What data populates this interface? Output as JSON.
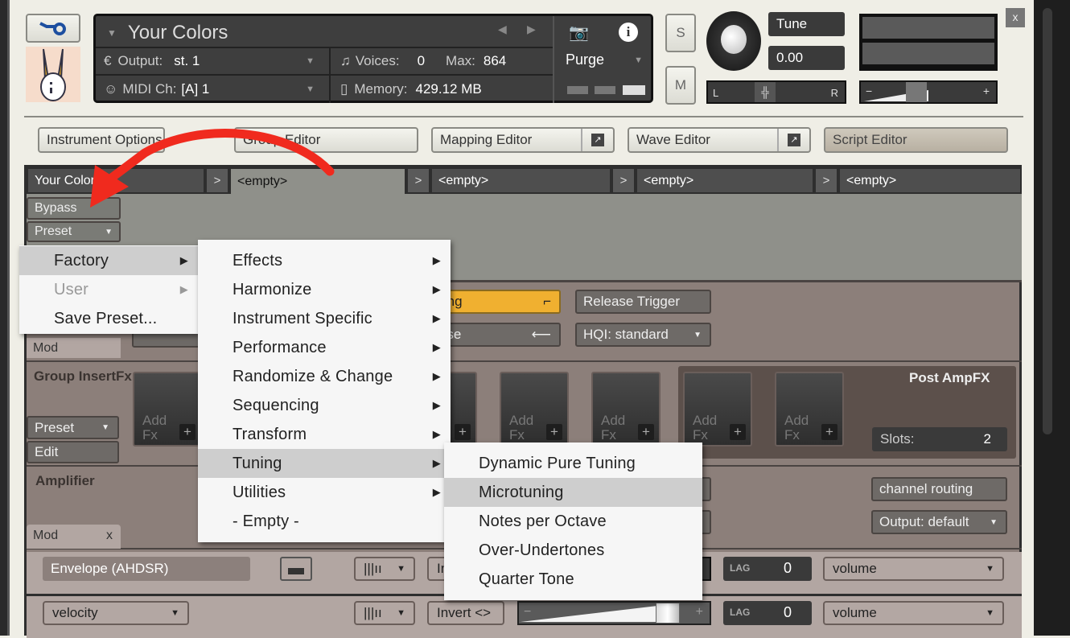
{
  "header": {
    "title": "Your Colors",
    "output_label": "Output:",
    "output_value": "st. 1",
    "midi_label": "MIDI Ch:",
    "midi_value": "[A]  1",
    "voices_label": "Voices:",
    "voices_value": "0",
    "max_label": "Max:",
    "max_value": "864",
    "memory_label": "Memory:",
    "memory_value": "429.12 MB",
    "purge_label": "Purge",
    "tune_label": "Tune",
    "tune_value": "0.00",
    "solo": "S",
    "mute": "M",
    "pan_left": "L",
    "pan_right": "R",
    "vol_minus": "−",
    "vol_plus": "+",
    "close": "x"
  },
  "editors": [
    "Instrument Options",
    "Group Editor",
    "Mapping Editor",
    "Wave Editor",
    "Script Editor"
  ],
  "tabs": [
    {
      "label": "Your Colors"
    },
    {
      "label": "<empty>"
    },
    {
      "label": "<empty>"
    },
    {
      "label": "<empty>"
    },
    {
      "label": "<empty>"
    }
  ],
  "tab_arrow": ">",
  "group": {
    "bypass": "Bypass",
    "preset": "Preset",
    "mod": "Mod"
  },
  "source": {
    "tracking": "Tracking",
    "release_trigger": "Release Trigger",
    "reverse": "Reverse",
    "hqi": "HQI: standard"
  },
  "insertfx": {
    "title": "Group InsertFx",
    "preset": "Preset",
    "edit": "Edit",
    "add_fx": "Add Fx",
    "plus": "+",
    "post_title": "Post AmpFX",
    "slots_label": "Slots:",
    "slots_value": "2"
  },
  "amplifier": {
    "title": "Amplifier",
    "channel_routing": "channel routing",
    "output": "Output: default",
    "mod_tab": "Mod",
    "mod_close": "x"
  },
  "mod_rows": [
    {
      "source": "Envelope (AHDSR)",
      "invert": "Invert <>",
      "lag_label": "LAG",
      "lag_value": "0",
      "target": "volume"
    },
    {
      "source": "velocity",
      "invert": "Invert <>",
      "lag_label": "LAG",
      "lag_value": "0",
      "target": "volume"
    }
  ],
  "menu1": [
    {
      "label": "Factory",
      "sub": true,
      "state": "highlighted"
    },
    {
      "label": "User",
      "sub": true,
      "state": "disabled"
    },
    {
      "label": "Save Preset...",
      "sub": false
    }
  ],
  "menu2": [
    {
      "label": "Effects"
    },
    {
      "label": "Harmonize"
    },
    {
      "label": "Instrument Specific"
    },
    {
      "label": "Performance"
    },
    {
      "label": "Randomize & Change"
    },
    {
      "label": "Sequencing"
    },
    {
      "label": "Transform"
    },
    {
      "label": "Tuning",
      "state": "highlighted"
    },
    {
      "label": "Utilities"
    },
    {
      "label": "- Empty -",
      "sub": false
    }
  ],
  "menu3": [
    {
      "label": "Dynamic Pure Tuning"
    },
    {
      "label": "Microtuning",
      "state": "highlighted"
    },
    {
      "label": "Notes per Octave"
    },
    {
      "label": "Over-Undertones"
    },
    {
      "label": "Quarter Tone"
    }
  ],
  "annotation": {
    "arrow_color": "#f02a1e"
  },
  "colors": {
    "tracking_active": "#f0b030",
    "panel": "#8c7f7a",
    "menu_highlight": "#cecece"
  }
}
